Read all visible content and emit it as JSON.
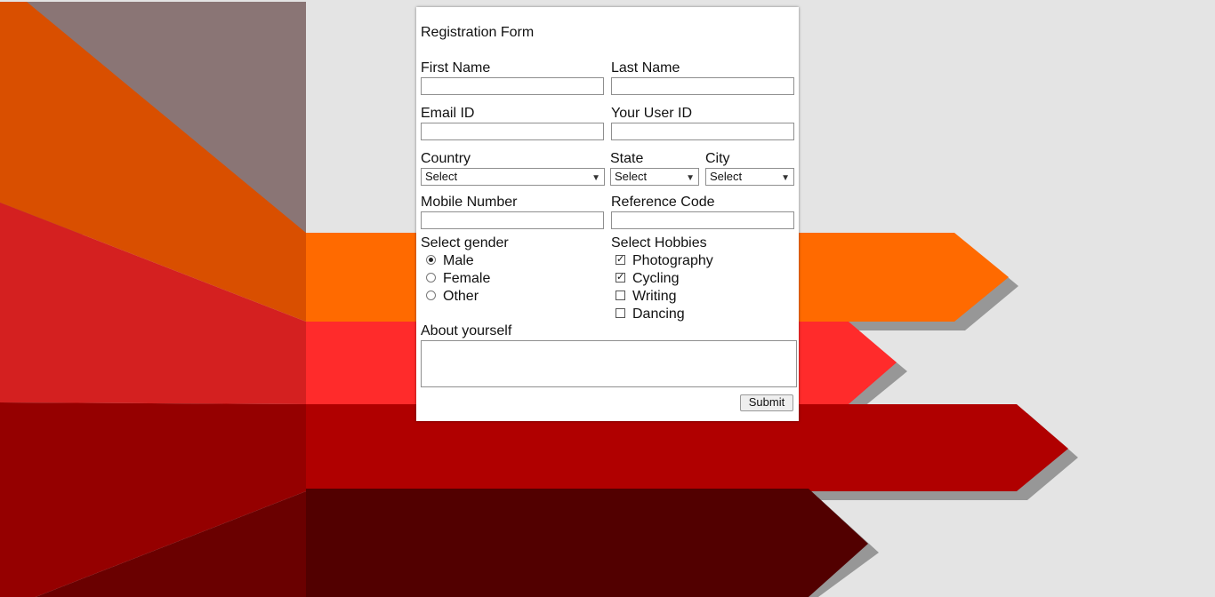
{
  "form": {
    "title": "Registration Form",
    "first_name": {
      "label": "First Name",
      "value": ""
    },
    "last_name": {
      "label": "Last Name",
      "value": ""
    },
    "email": {
      "label": "Email ID",
      "value": ""
    },
    "user_id": {
      "label": "Your User ID",
      "value": ""
    },
    "country": {
      "label": "Country",
      "selected": "Select"
    },
    "state": {
      "label": "State",
      "selected": "Select"
    },
    "city": {
      "label": "City",
      "selected": "Select"
    },
    "mobile": {
      "label": "Mobile Number",
      "value": ""
    },
    "reference": {
      "label": "Reference Code",
      "value": ""
    },
    "gender": {
      "label": "Select gender",
      "options": [
        {
          "label": "Male",
          "checked": true
        },
        {
          "label": "Female",
          "checked": false
        },
        {
          "label": "Other",
          "checked": false
        }
      ]
    },
    "hobbies": {
      "label": "Select Hobbies",
      "options": [
        {
          "label": "Photography",
          "checked": true
        },
        {
          "label": "Cycling",
          "checked": true
        },
        {
          "label": "Writing",
          "checked": false
        },
        {
          "label": "Dancing",
          "checked": false
        }
      ]
    },
    "about": {
      "label": "About yourself",
      "value": ""
    },
    "submit_label": "Submit"
  },
  "colors": {
    "page_bg": "#e4e4e4",
    "stripe_orange": "#ff6a00",
    "stripe_red": "#ff2b2b",
    "stripe_crimson": "#b00000",
    "stripe_maroon": "#520000",
    "top_left_panel": "#8a7575",
    "wedge_orange": "#d94f00",
    "wedge_red": "#d42020"
  }
}
